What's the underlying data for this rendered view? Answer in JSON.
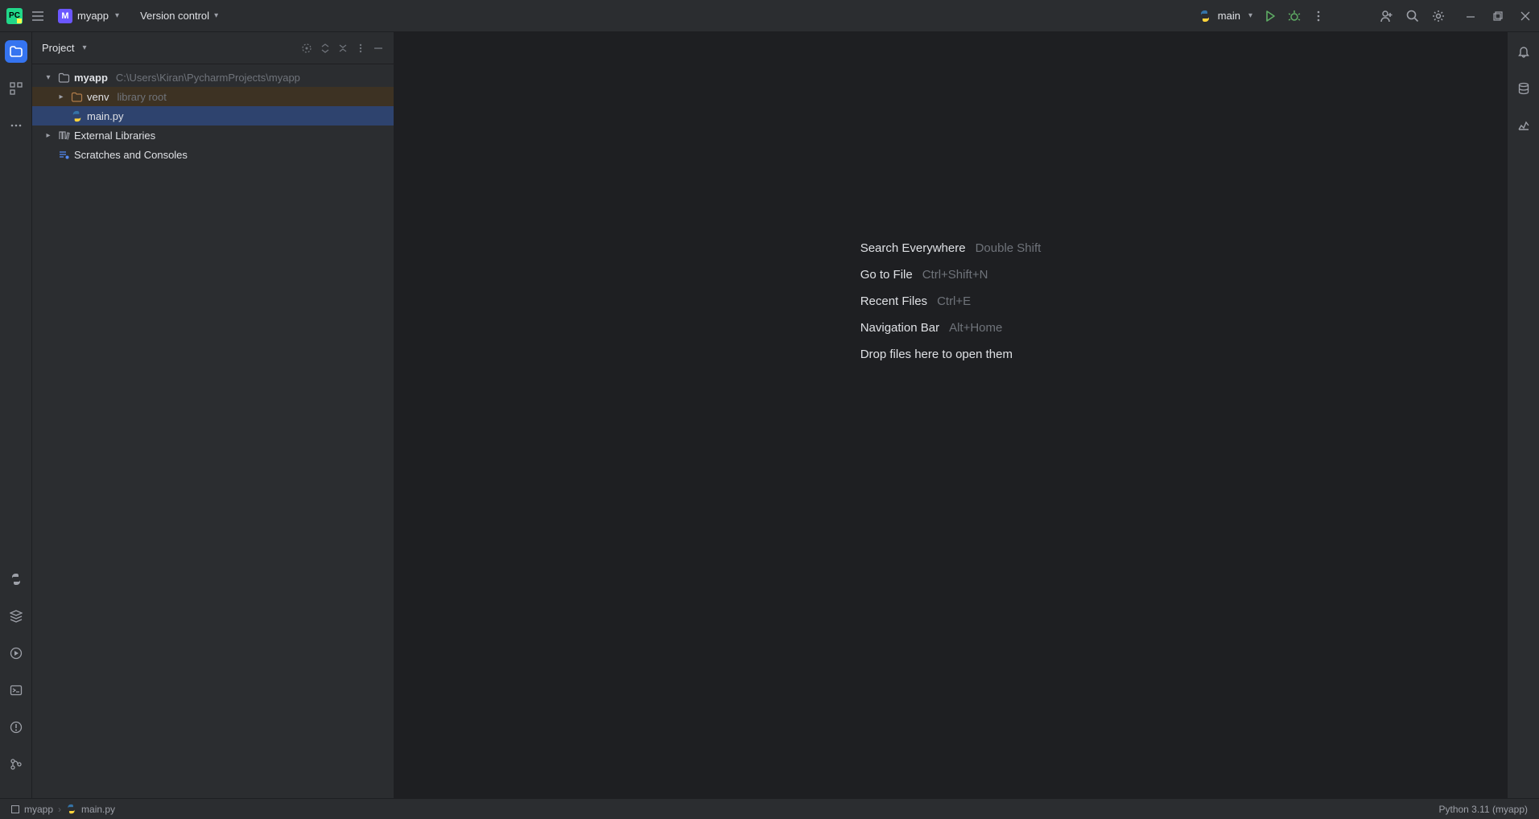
{
  "titlebar": {
    "project_badge": "M",
    "project_name": "myapp",
    "vcs_label": "Version control"
  },
  "run": {
    "config_name": "main"
  },
  "project_panel": {
    "title": "Project"
  },
  "tree": {
    "root": {
      "name": "myapp",
      "path": "C:\\Users\\Kiran\\PycharmProjects\\myapp"
    },
    "venv": {
      "name": "venv",
      "hint": "library root"
    },
    "mainpy": {
      "name": "main.py"
    },
    "ext_libs": "External Libraries",
    "scratches": "Scratches and Consoles"
  },
  "empty": {
    "e1_name": "Search Everywhere",
    "e1_keys": "Double Shift",
    "e2_name": "Go to File",
    "e2_keys": "Ctrl+Shift+N",
    "e3_name": "Recent Files",
    "e3_keys": "Ctrl+E",
    "e4_name": "Navigation Bar",
    "e4_keys": "Alt+Home",
    "e5_name": "Drop files here to open them"
  },
  "statusbar": {
    "crumb1": "myapp",
    "crumb2": "main.py",
    "interpreter": "Python 3.11 (myapp)"
  }
}
